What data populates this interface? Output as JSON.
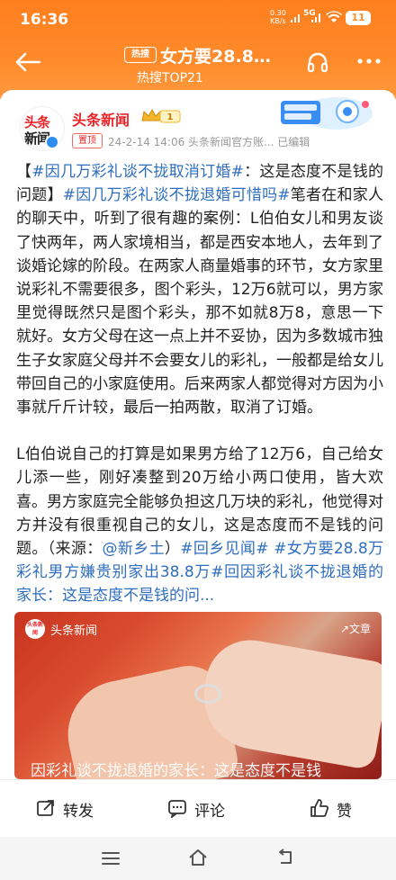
{
  "status_bar": {
    "time": "16:36",
    "net_speed_value": "0.30",
    "net_speed_unit": "KB/s",
    "net_type": "5G",
    "battery": "11"
  },
  "header": {
    "badge": "热搜",
    "title": "女方要28.8…",
    "subtitle": "热搜TOP21"
  },
  "post": {
    "avatar_line1": "头条",
    "avatar_line2": "新闻",
    "author": "头条新闻",
    "level": "1",
    "pin_tag": "置顶",
    "meta": "24-2-14 14:06  头条新闻官方账...  已编辑",
    "paragraphs": [
      [
        {
          "t": "【",
          "topic": false
        },
        {
          "t": "#因几万彩礼谈不拢取消订婚#",
          "topic": true
        },
        {
          "t": "：这是态度不是钱的问题】",
          "topic": false
        },
        {
          "t": "#因几万彩礼谈不拢退婚可惜吗#",
          "topic": true
        },
        {
          "t": "笔者在和家人的聊天中，听到了很有趣的案例：L伯伯女儿和男友谈了快两年，两人家境相当，都是西安本地人，去年到了谈婚论嫁的阶段。在两家人商量婚事的环节，女方家里说彩礼不需要很多，图个彩头，12万6就可以，男方家里觉得既然只是图个彩头，那不如就8万8，意思一下就好。女方父母在这一点上并不妥协，因为多数城市独生子女家庭父母并不会要女儿的彩礼，一般都是给女儿带回自己的小家庭使用。后来两家人都觉得对方因为小事就斤斤计较，最后一拍两散，取消了订婚。",
          "topic": false
        }
      ],
      [
        {
          "t": "L伯伯说自己的打算是如果男方给了12万6，自己给女儿添一些，刚好凑整到20万给小两口使用，皆大欢喜。男方家庭完全能够负担这几万块的彩礼，他觉得对方并没有很重视自己的女儿，这是态度而不是钱的问题。（来源：",
          "topic": false
        },
        {
          "t": "@新乡土",
          "topic": true
        },
        {
          "t": "）",
          "topic": false
        },
        {
          "t": "#回乡见闻#",
          "topic": true
        },
        {
          "t": " ",
          "topic": false
        },
        {
          "t": "#女方要28.8万彩礼男方嫌贵别家出38.8万#",
          "topic": true
        },
        {
          "t": "回因彩礼谈不拢退婚的家长：这是态度不是钱的问...",
          "topic": true
        }
      ]
    ]
  },
  "video": {
    "source_logo": "头条新闻",
    "source": "头条新闻",
    "article_label": "↗文章",
    "caption": "因彩礼谈不拢退婚的家长：这是态度不是钱"
  },
  "actions": {
    "repost": "转发",
    "comment": "评论",
    "like": "赞"
  },
  "colors": {
    "header": "#ff8a2a",
    "topic": "#2f6ebf",
    "author": "#e8262a"
  }
}
